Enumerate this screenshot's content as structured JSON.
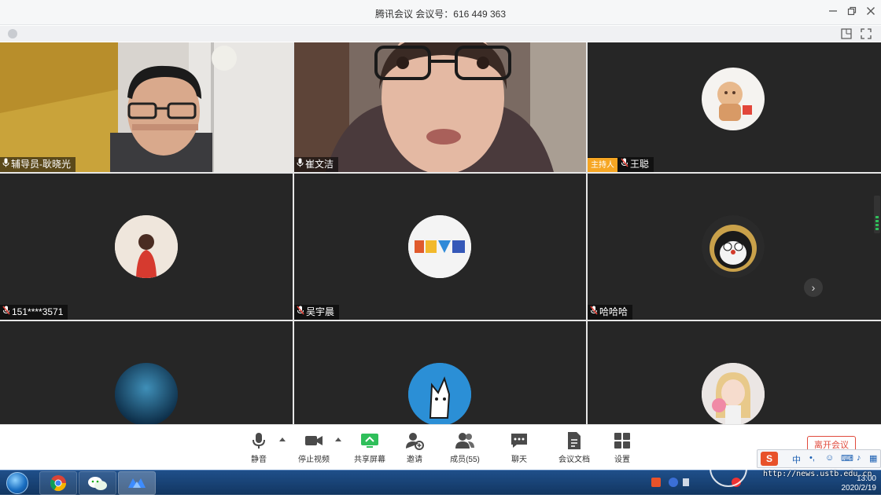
{
  "window": {
    "title": "腾讯会议 会议号：616 449 363",
    "controls": [
      "minimize-icon",
      "restore-icon",
      "close-icon"
    ]
  },
  "participants": [
    {
      "name": "辅导员-耿晓光",
      "video": true,
      "mic": "on"
    },
    {
      "name": "崔文洁",
      "video": true,
      "mic": "on"
    },
    {
      "name": "王聪",
      "video": false,
      "mic": "muted",
      "host": true,
      "host_label": "主持人"
    },
    {
      "name": "151****3571",
      "video": false,
      "mic": "muted"
    },
    {
      "name": "吴宇晨",
      "video": false,
      "mic": "muted"
    },
    {
      "name": "哈哈哈",
      "video": false,
      "mic": "muted"
    },
    {
      "name": "",
      "video": false
    },
    {
      "name": "",
      "video": false
    },
    {
      "name": "",
      "video": false
    }
  ],
  "toolbar": {
    "mute": "静音",
    "stop_video": "停止视频",
    "share_screen": "共享屏幕",
    "invite": "邀请",
    "members": "成员(55)",
    "chat": "聊天",
    "docs": "会议文档",
    "settings": "设置",
    "leave": "离开会议"
  },
  "taskbar": {
    "apps": [
      "chrome-icon",
      "wechat-icon",
      "tencent-meeting-icon"
    ],
    "clock_time": "13:00",
    "clock_date": "2020/2/19",
    "ime": {
      "mode": "中"
    }
  },
  "watermark": {
    "url": "http://news.ustb.edu.cn"
  },
  "colors": {
    "tile_bg": "#262626",
    "host_badge": "#f6a623",
    "share_green": "#2fbf5a",
    "leave_red": "#e04a3c",
    "taskbar": "#1f4f8a"
  }
}
